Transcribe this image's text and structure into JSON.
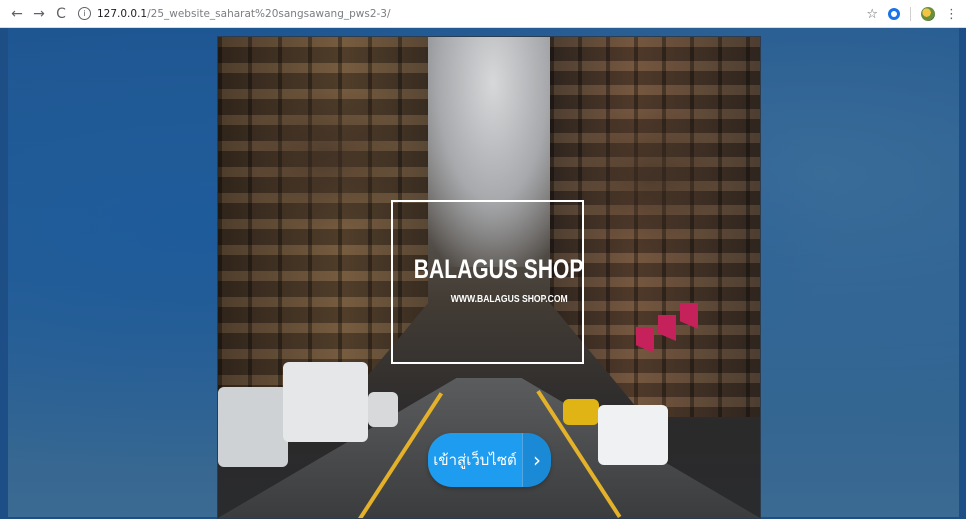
{
  "browser": {
    "url_host": "127.0.0.1",
    "url_path": "/25_website_saharat%20sangsawang_pws2-3/"
  },
  "hero": {
    "brand_title": "BALAGUS SHOP",
    "brand_subtitle": "WWW.BALAGUS SHOP.COM",
    "enter_button_label": "เข้าสู่เว็บไซต์",
    "enter_button_arrow": "›",
    "background_image": "city-street-photo"
  },
  "colors": {
    "page_bg": "#1d4f86",
    "button_primary": "#1e9cf0",
    "button_arrow": "#1b8ad6"
  }
}
